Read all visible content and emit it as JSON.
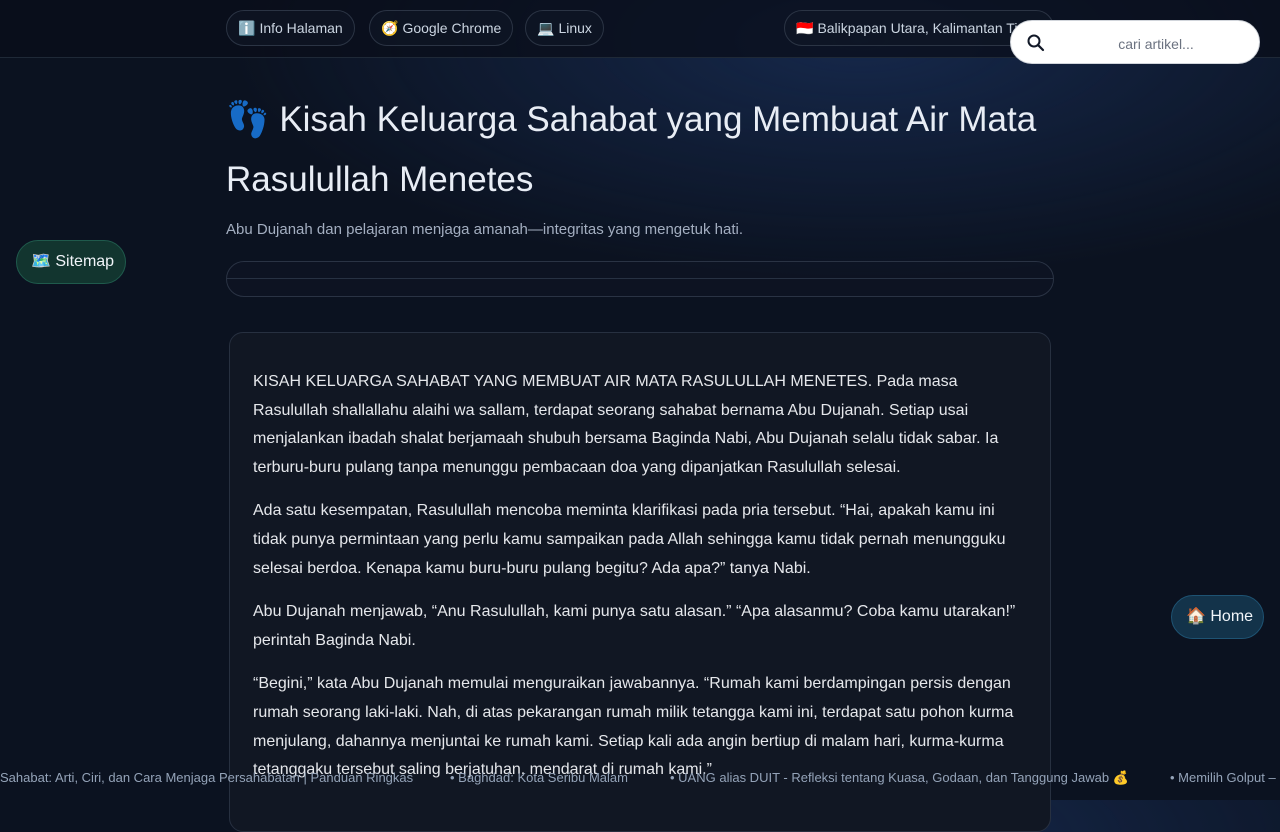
{
  "topbar": {
    "chips": [
      {
        "icon": "ℹ️",
        "label": "Info Halaman"
      },
      {
        "icon": "🧭",
        "label": "Google Chrome"
      },
      {
        "icon": "💻",
        "label": "Linux"
      },
      {
        "icon": "🇮🇩",
        "label": "Balikpapan Utara, Kalimantan Timur"
      }
    ],
    "search": {
      "placeholder": "cari artikel..."
    }
  },
  "floating": {
    "sitemap": {
      "icon": "🗺️",
      "label": "Sitemap"
    },
    "home": {
      "icon": "🏠",
      "label": "Home"
    }
  },
  "article": {
    "title_emoji": "👣",
    "title": "Kisah Keluarga Sahabat yang Membuat Air Mata Rasulullah Menetes",
    "subtitle": "Abu Dujanah dan pelajaran menjaga amanah—integritas yang mengetuk hati.",
    "paragraphs": [
      "KISAH KELUARGA SAHABAT YANG MEMBUAT AIR MATA RASULULLAH MENETES. Pada masa Rasulullah shallallahu alaihi wa sallam, terdapat seorang sahabat bernama Abu Dujanah. Setiap usai menjalankan ibadah shalat berjamaah shubuh bersama Baginda Nabi, Abu Dujanah selalu tidak sabar. Ia terburu-buru pulang tanpa menunggu pembacaan doa yang dipanjatkan Rasulullah selesai.",
      "Ada satu kesempatan, Rasulullah mencoba meminta klarifikasi pada pria tersebut. “Hai, apakah kamu ini tidak punya permintaan yang perlu kamu sampaikan pada Allah sehingga kamu tidak pernah menungguku selesai berdoa. Kenapa kamu buru-buru pulang begitu? Ada apa?” tanya Nabi.",
      "Abu Dujanah menjawab, “Anu Rasulullah, kami punya satu alasan.” “Apa alasanmu? Coba kamu utarakan!” perintah Baginda Nabi.",
      "“Begini,” kata Abu Dujanah memulai menguraikan jawabannya. “Rumah kami berdampingan persis dengan rumah seorang laki-laki. Nah, di atas pekarangan rumah milik tetangga kami ini, terdapat satu pohon kurma menjulang, dahannya menjuntai ke rumah kami. Setiap kali ada angin bertiup di malam hari, kurma-kurma tetanggaku tersebut saling berjatuhan, mendarat di rumah kami.”"
    ]
  },
  "ticker": [
    "Sahabat: Arti, Ciri, dan Cara Menjaga Persahabatan | Panduan Ringkas",
    "• Baghdad: Kota Seribu Malam",
    "• UANG alias DUIT - Refleksi tentang Kuasa, Godaan, dan Tanggung Jawab 💰",
    "• Memilih Golput – "
  ]
}
